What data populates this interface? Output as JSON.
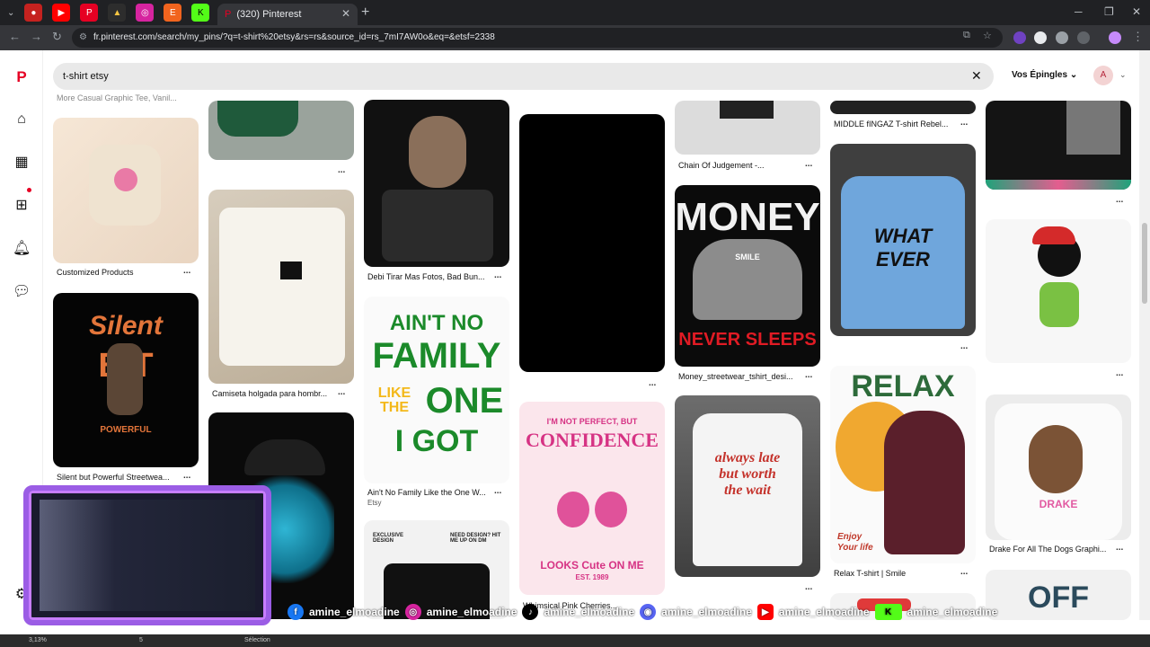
{
  "browser": {
    "tab_title": "(320) Pinterest",
    "url": "fr.pinterest.com/search/my_pins/?q=t-shirt%20etsy&rs=rs&source_id=rs_7mI7AW0o&eq=&etsf=2338"
  },
  "search": {
    "query": "t-shirt etsy",
    "scope_label": "Vos Épingles"
  },
  "user": {
    "avatar_letter": "A"
  },
  "pins": {
    "customized_products": "Customized Products",
    "silent_but_powerful": "Silent but Powerful Streetwea...",
    "camiseta": "Camiseta holgada para hombr...",
    "debi_tirar": "Debi Tirar Mas Fotos, Bad Bun...",
    "aint_no_family": "Ain't No Family Like the One W...",
    "aint_no_family_source": "Etsy",
    "whimsical": "Whimsical Pink Cherries...",
    "chain_of_judgement": "Chain Of Judgement -...",
    "money_streetwear": "Money_streetwear_tshirt_desi...",
    "middle_fingaz": "MIDDLE fINGAZ T-shirt Rebel...",
    "relax_tshirt": "Relax T-shirt | Smile",
    "drake": "Drake For All The Dogs Graphi...",
    "more": "...",
    "more_casual": "More Casual Graphic Tee, Vanil..."
  },
  "art_text": {
    "silent": "Silent",
    "bot": "B T",
    "powerful": "POWERFUL",
    "aint": "AIN'T NO",
    "family": "FAMILY",
    "like_the": "LIKE THE",
    "one": "ONE",
    "i_got": "I GOT",
    "not_perfect": "I'M NOT PERFECT, BUT",
    "confidence": "CONFIDENCE",
    "looks_cute": "LOOKS Cute ON ME",
    "est": "EST. 1989",
    "money": "MONEY",
    "smile": "SMILE",
    "never_sleeps": "NEVER SLEEPS",
    "what": "WHAT",
    "ever": "EVER",
    "always_late": "always late",
    "but_worth": "but worth",
    "the_wait": "the wait",
    "relax": "RELAX",
    "enjoy": "Enjoy",
    "your_life": "Your life",
    "exclusive_design": "EXCLUSIVE DESIGN",
    "need_design": "NEED DESIGN? HIT ME UP ON DM",
    "drake": "DRAKE",
    "off": "OFF"
  },
  "overlay": {
    "handles": [
      "amine_elmoadine",
      "amine_elmoadine",
      "amine_elmoadine",
      "amine_elmoadine",
      "amine_elmoadine",
      "amine_elmoadine"
    ]
  },
  "status_bar": {
    "zoom": "3,13%",
    "page": "5",
    "selection": "Sélection"
  },
  "colors": {
    "pinterest_red": "#e60023",
    "search_bg": "#e9e9e9"
  }
}
